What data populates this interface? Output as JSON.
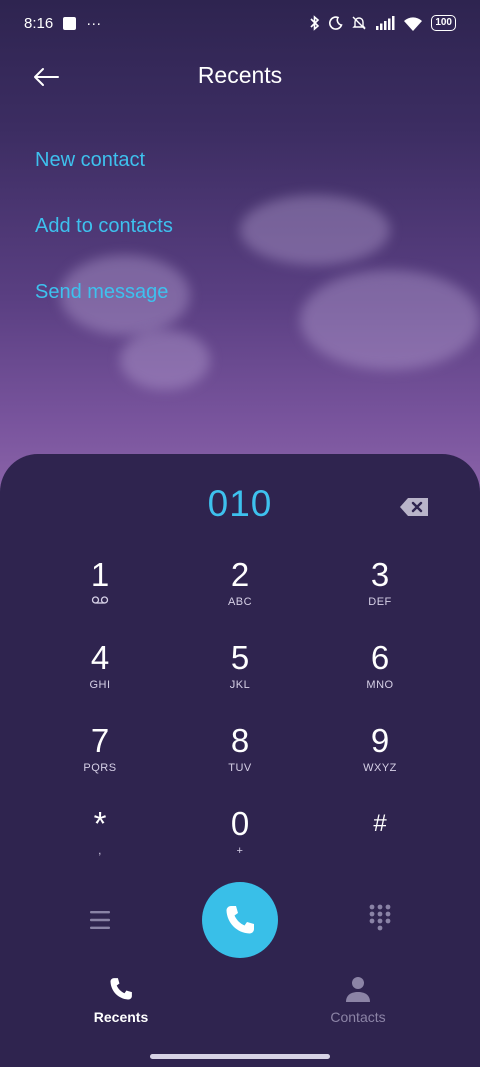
{
  "status_bar": {
    "time": "8:16",
    "dots": "···",
    "battery": "100"
  },
  "header": {
    "title": "Recents"
  },
  "actions": [
    {
      "label": "New contact"
    },
    {
      "label": "Add to contacts"
    },
    {
      "label": "Send message"
    }
  ],
  "dialer": {
    "dialed_number": "010",
    "keys": [
      {
        "digit": "1",
        "letters": ""
      },
      {
        "digit": "2",
        "letters": "ABC"
      },
      {
        "digit": "3",
        "letters": "DEF"
      },
      {
        "digit": "4",
        "letters": "GHI"
      },
      {
        "digit": "5",
        "letters": "JKL"
      },
      {
        "digit": "6",
        "letters": "MNO"
      },
      {
        "digit": "7",
        "letters": "PQRS"
      },
      {
        "digit": "8",
        "letters": "TUV"
      },
      {
        "digit": "9",
        "letters": "WXYZ"
      },
      {
        "digit": "*",
        "letters": ","
      },
      {
        "digit": "0",
        "letters": "+"
      },
      {
        "digit": "#",
        "letters": ""
      }
    ]
  },
  "tabs": [
    {
      "label": "Recents",
      "active": true,
      "icon": "phone-icon"
    },
    {
      "label": "Contacts",
      "active": false,
      "icon": "person-icon"
    }
  ],
  "colors": {
    "accent": "#3ec1ee",
    "call_button": "#39bfe8",
    "panel": "#2f244f"
  }
}
